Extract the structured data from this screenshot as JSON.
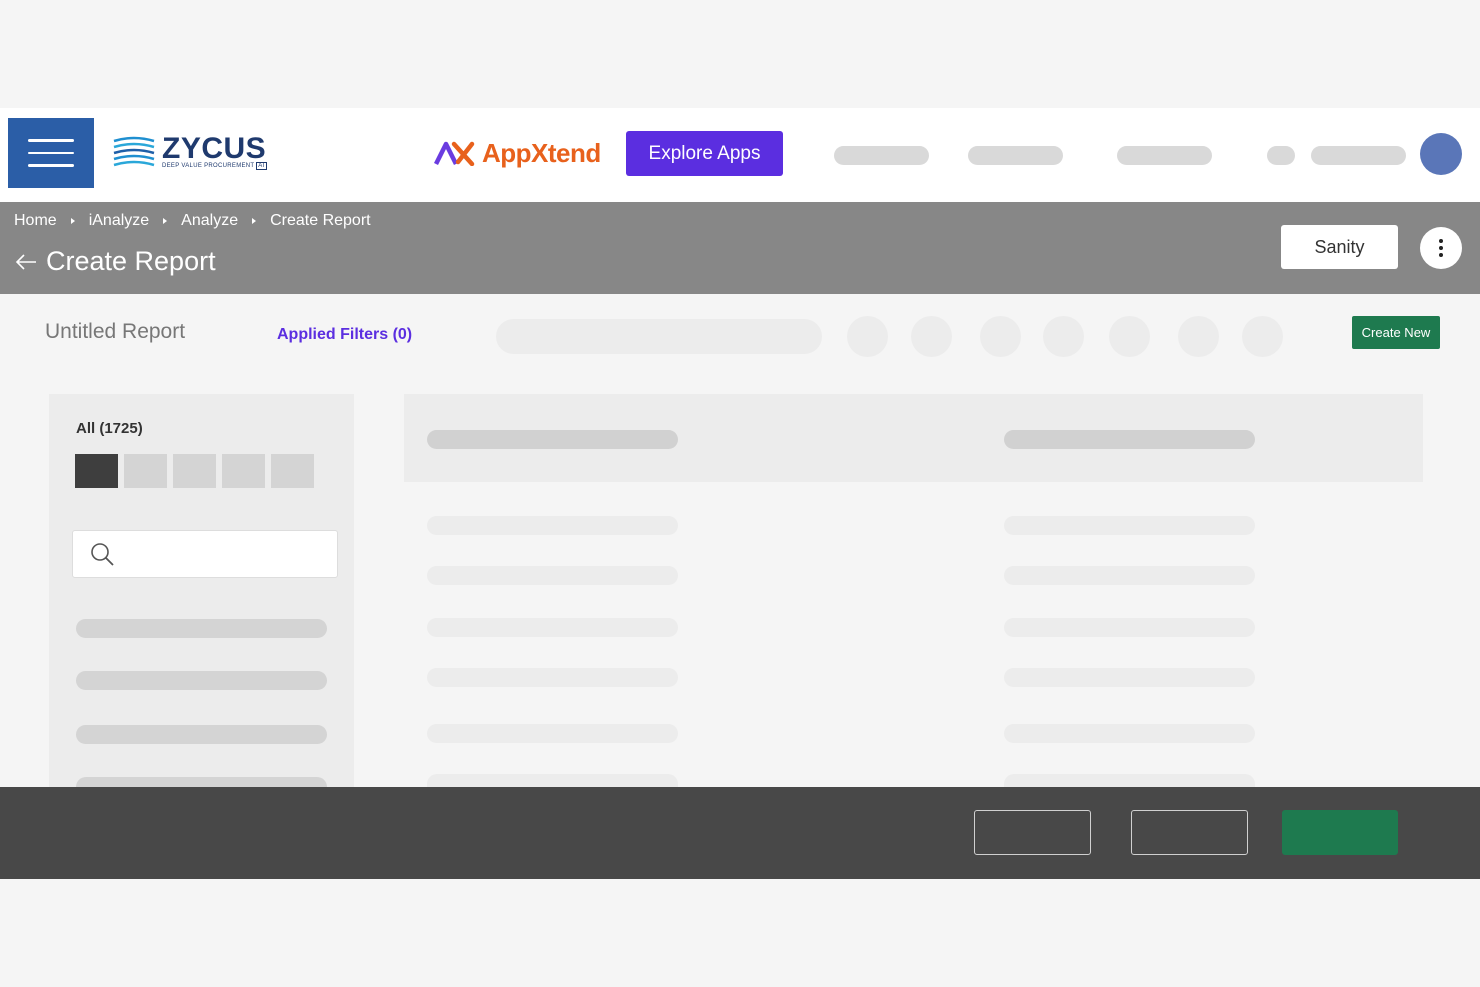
{
  "topbar": {
    "brand_name": "ZYCUS",
    "brand_tagline": "DEEP VALUE PROCUREMENT",
    "brand_badge": "AI",
    "appxtend_label": "AppXtend",
    "explore_apps_label": "Explore Apps"
  },
  "header": {
    "breadcrumbs": [
      "Home",
      "iAnalyze",
      "Analyze",
      "Create Report"
    ],
    "title": "Create Report",
    "sanity_label": "Sanity"
  },
  "toolbar": {
    "report_name": "Untitled Report",
    "applied_filters_label": "Applied Filters (0)",
    "create_new_label": "Create New"
  },
  "left_panel": {
    "all_count_label": "All (1725)",
    "search_placeholder": ""
  },
  "colors": {
    "brand_blue": "#2b5ea7",
    "explore_purple": "#5b2ee0",
    "header_gray": "#878787",
    "footer_dark": "#484848",
    "action_green": "#1e7a4f",
    "appxtend_orange": "#e8611c"
  }
}
